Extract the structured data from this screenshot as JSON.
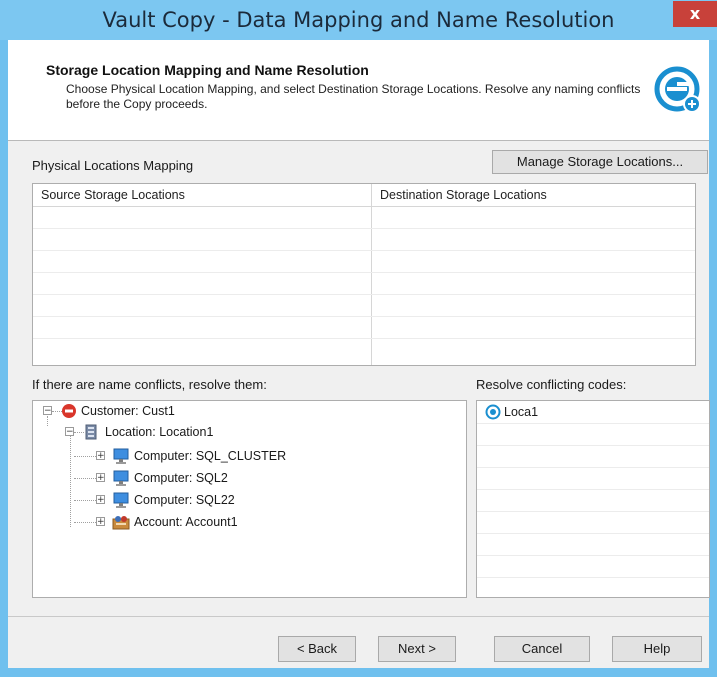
{
  "window": {
    "title": "Vault Copy - Data Mapping and Name Resolution",
    "close_label": "x"
  },
  "header": {
    "title": "Storage Location Mapping and Name Resolution",
    "description": "Choose Physical Location Mapping, and select Destination Storage Locations. Resolve any naming conflicts before the Copy proceeds."
  },
  "mapping": {
    "label": "Physical Locations Mapping",
    "manage_button": "Manage Storage Locations...",
    "columns": [
      "Source Storage Locations",
      "Destination Storage Locations"
    ]
  },
  "conflicts": {
    "label": "If there are name conflicts, resolve them:",
    "tree": [
      {
        "label": "Customer: Cust1",
        "icon": "customer-icon",
        "expander": "−"
      },
      {
        "label": "Location: Location1",
        "icon": "location-icon",
        "expander": "−"
      },
      {
        "label": "Computer: SQL_CLUSTER",
        "icon": "computer-icon",
        "expander": "+"
      },
      {
        "label": "Computer: SQL2",
        "icon": "computer-icon",
        "expander": "+"
      },
      {
        "label": "Computer: SQL22",
        "icon": "computer-icon",
        "expander": "+"
      },
      {
        "label": "Account: Account1",
        "icon": "account-icon",
        "expander": "+"
      }
    ]
  },
  "codes": {
    "label": "Resolve conflicting codes:",
    "items": [
      {
        "label": "Loca1",
        "icon": "code-icon"
      }
    ]
  },
  "footer": {
    "back": "< Back",
    "next": "Next >",
    "cancel": "Cancel",
    "help": "Help"
  },
  "colors": {
    "title_bar": "#7cc7f1",
    "close_button": "#c8413a",
    "logo": "#1a8fd0"
  }
}
